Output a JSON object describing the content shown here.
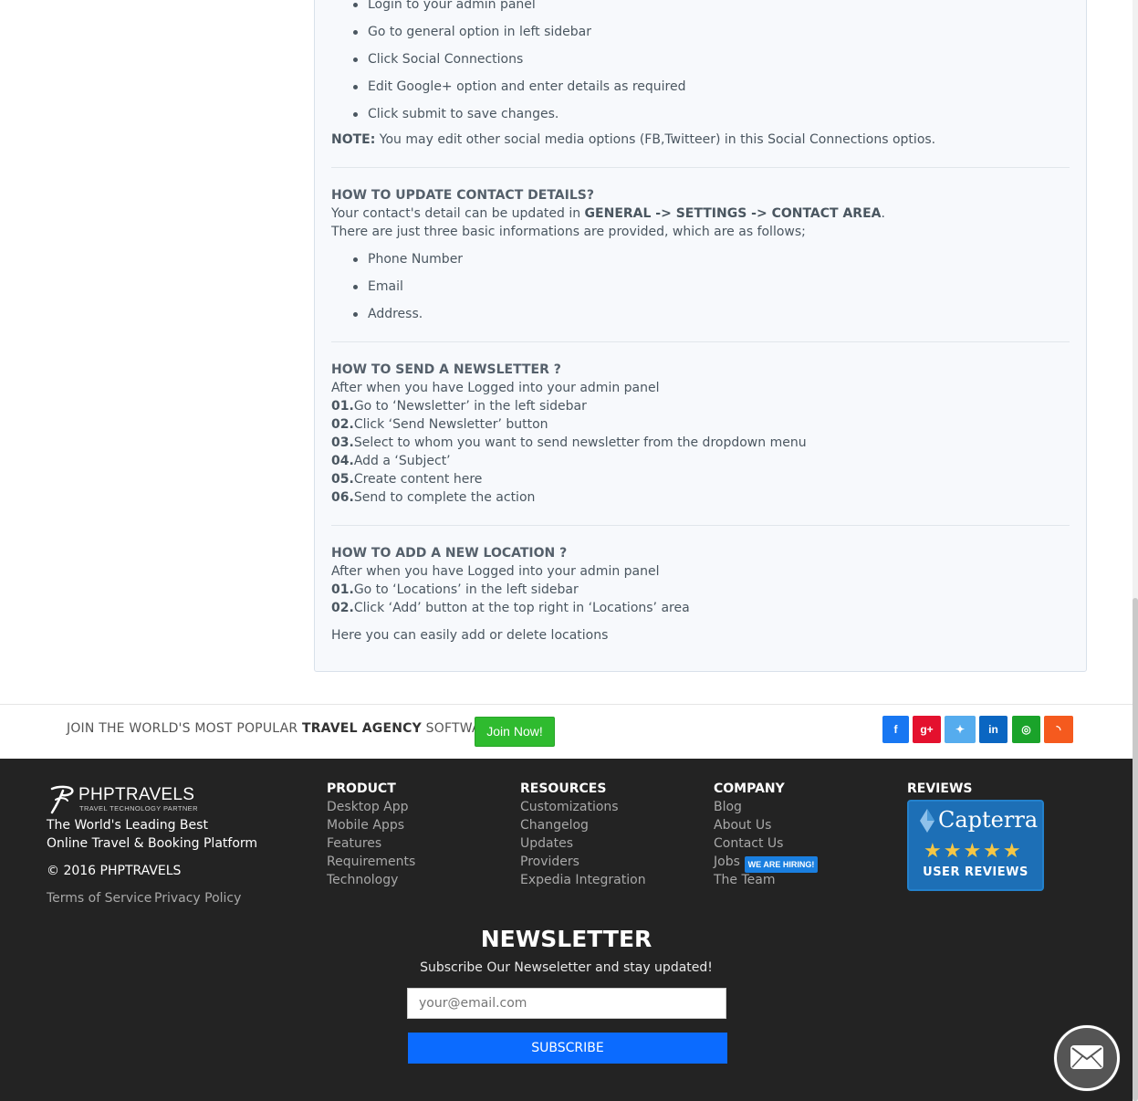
{
  "social_section": {
    "bullets": [
      "Login to your admin panel",
      "Go to general option in left sidebar",
      "Click Social Connections",
      "Edit Google+ option and enter details as required",
      "Click submit to save changes."
    ],
    "note_label": "NOTE:",
    "note_text": " You may edit other social media options (FB,Twitteer) in this Social Connections optios."
  },
  "contact_section": {
    "heading": "HOW TO UPDATE CONTACT DETAILS?",
    "line1_prefix": "Your contact's detail can be updated in ",
    "line1_path": "GENERAL -> SETTINGS -> CONTACT AREA",
    "line1_suffix": ".",
    "line2": "There are just three basic informations are provided, which are as follows;",
    "bullets": [
      "Phone Number",
      "Email",
      "Address."
    ]
  },
  "newsletter_section": {
    "heading": "HOW TO SEND A NEWSLETTER ?",
    "intro": "After when you have Logged into your admin panel",
    "steps": [
      {
        "num": "01.",
        "text": "Go to ‘Newsletter’ in the left sidebar"
      },
      {
        "num": "02.",
        "text": "Click ‘Send Newsletter’ button"
      },
      {
        "num": "03.",
        "text": "Select to whom you want to send newsletter from the dropdown menu"
      },
      {
        "num": "04.",
        "text": "Add a ‘Subject’"
      },
      {
        "num": "05.",
        "text": "Create content here"
      },
      {
        "num": "06.",
        "text": "Send to complete the action"
      }
    ]
  },
  "location_section": {
    "heading": "HOW TO ADD A NEW LOCATION ?",
    "intro": "After when you have Logged into your admin panel",
    "steps": [
      {
        "num": "01.",
        "text": "Go to ‘Locations’ in the left sidebar"
      },
      {
        "num": "02.",
        "text": "Click ‘Add’ button at the top right in ‘Locations’ area"
      }
    ],
    "outro": "Here you can easily add or delete locations"
  },
  "join_bar": {
    "text_prefix": "JOIN THE WORLD'S MOST POPULAR ",
    "text_bold": "TRAVEL AGENCY",
    "text_suffix": " SOFTWARE",
    "button": "Join Now!",
    "social": [
      {
        "icon": "facebook-icon",
        "glyph": "f",
        "color": "#1877f2"
      },
      {
        "icon": "google-plus-icon",
        "glyph": "g+",
        "color": "#e4112e"
      },
      {
        "icon": "twitter-icon",
        "glyph": "✦",
        "color": "#55acee"
      },
      {
        "icon": "linkedin-icon",
        "glyph": "in",
        "color": "#0a66c2"
      },
      {
        "icon": "instagram-icon",
        "glyph": "◎",
        "color": "#1aa32a"
      },
      {
        "icon": "rss-icon",
        "glyph": "◝",
        "color": "#f55a1e"
      }
    ]
  },
  "footer": {
    "brand_name": "PHPTRAVELS",
    "brand_tag": "TRAVEL TECHNOLOGY PARTNER",
    "tagline1": "The World's Leading Best",
    "tagline2": "Online Travel & Booking Platform",
    "copyright": "© 2016 PHPTRAVELS",
    "terms": "Terms of Service",
    "privacy": "Privacy Policy",
    "product": {
      "heading": "PRODUCT",
      "links": [
        "Desktop App",
        "Mobile Apps",
        "Features",
        "Requirements",
        "Technology"
      ]
    },
    "resources": {
      "heading": "RESOURCES",
      "links": [
        "Customizations",
        "Changelog",
        "Updates",
        "Providers",
        "Expedia Integration"
      ]
    },
    "company": {
      "heading": "COMPANY",
      "links": [
        "Blog",
        "About Us",
        "Contact Us",
        "Jobs",
        "The Team"
      ],
      "hiring_badge": "WE ARE HIRING!"
    },
    "reviews": {
      "heading": "REVIEWS",
      "capterra_name": "Capterra",
      "stars": "★★★★★",
      "label": "USER REVIEWS"
    },
    "newsletter": {
      "title": "NEWSLETTER",
      "subtitle": "Subscribe Our Newseletter and stay updated!",
      "placeholder": "your@email.com",
      "button": "SUBSCRIBE"
    }
  }
}
